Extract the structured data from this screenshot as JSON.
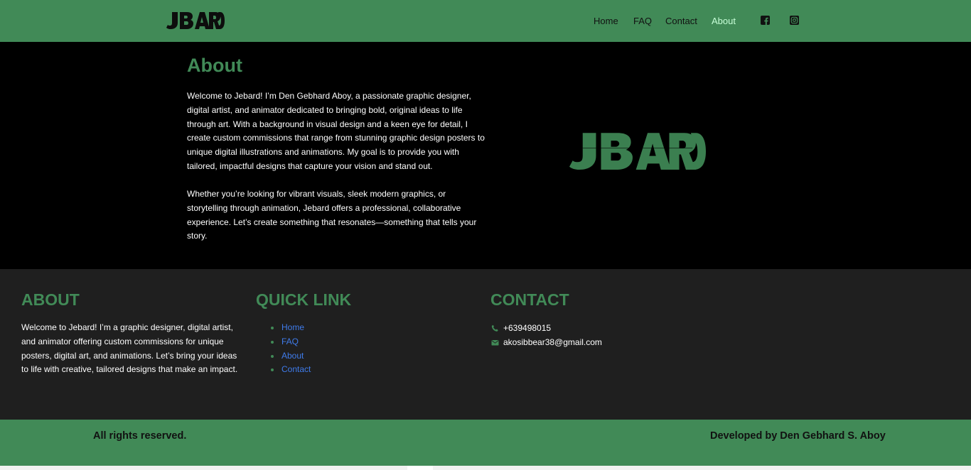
{
  "header": {
    "logo_text": "JEBARD",
    "nav": [
      "Home",
      "FAQ",
      "Contact",
      "About"
    ],
    "active_nav": "About",
    "social_icons": [
      "facebook-icon",
      "instagram-icon"
    ]
  },
  "hero": {
    "title": "About",
    "paragraphs": [
      "Welcome to Jebard! I’m Den Gebhard Aboy, a passionate graphic designer, digital artist, and animator dedicated to bringing bold, original ideas to life through art. With a background in visual design and a keen eye for detail, I create custom commissions that range from stunning graphic design posters to unique digital illustrations and animations. My goal is to provide you with tailored, impactful designs that capture your vision and stand out.",
      "Whether you’re looking for vibrant visuals, sleek modern graphics, or storytelling through animation, Jebard offers a professional, collaborative experience. Let’s create something that resonates—something that tells your story."
    ]
  },
  "footer": {
    "about_heading": "ABOUT",
    "about_text": "Welcome to Jebard! I’m a graphic designer, digital artist, and animator offering custom commissions for unique posters, digital art, and animations. Let’s bring your ideas to life with creative, tailored designs that make an impact.",
    "links_heading": "QUICK LINK",
    "links": [
      "Home",
      "FAQ",
      "About",
      "Contact"
    ],
    "contact_heading": "CONTACT",
    "phone": "+639498015",
    "email": "akosibbear38@gmail.com"
  },
  "bottom": {
    "rights": "All rights reserved.",
    "credit": "Developed by Den Gebhard S. Aboy"
  },
  "colors": {
    "brand_green": "#418a57",
    "active_nav": "#c8ffd8",
    "link_blue": "#3f7bea",
    "footer_bg": "#1f1f1f",
    "hero_bg": "#000000"
  }
}
